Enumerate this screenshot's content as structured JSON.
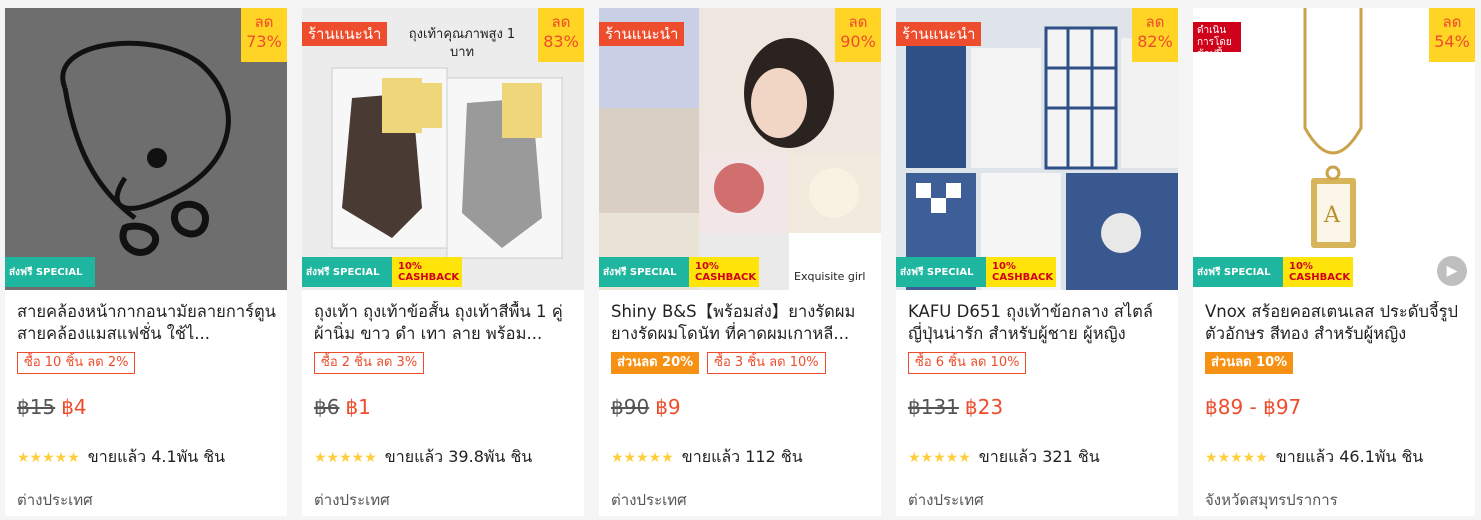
{
  "products": [
    {
      "image_bg": "#6a6a6a",
      "discount_word": "ลด",
      "discount_pct": "73%",
      "badge": "",
      "cashback": "",
      "title": "สายคล้องหน้ากากอนามัยลายการ์ตูน สายคล้องแมสแฟชั่น ใช้ไ...",
      "promos": [
        {
          "type": "box",
          "text": "ซื้อ 10 ชิ้น ลด 2%"
        }
      ],
      "price_old": "฿15",
      "price_new": "฿4",
      "sold": "ขายแล้ว 4.1พัน ชิน",
      "location": "ต่างประเทศ"
    },
    {
      "image_bg": "#e8e8e8",
      "discount_word": "ลด",
      "discount_pct": "83%",
      "badge": "ร้านแนะนำ",
      "image_caption": "ถุงเท้าคุณภาพสูง 1 บาท",
      "cashback": "10%",
      "title": "ถุงเท้า ถุงเท้าข้อสั้น ถุงเท้าสีพื้น 1 คู่ ผ้านิ่ม ขาว ดำ เทา ลาย พร้อม...",
      "promos": [
        {
          "type": "box",
          "text": "ซื้อ 2 ชิ้น ลด 3%"
        }
      ],
      "price_old": "฿6",
      "price_new": "฿1",
      "sold": "ขายแล้ว 39.8พัน ชิน",
      "location": "ต่างประเทศ"
    },
    {
      "image_bg": "#dcd6cf",
      "discount_word": "ลด",
      "discount_pct": "90%",
      "badge": "ร้านแนะนำ",
      "image_caption": "Exquisite girl",
      "cashback": "10%",
      "title": "Shiny B&S【พร้อมส่ง】ยางรัดผม ยางรัดผมโดนัท ที่คาดผมเกาหลี...",
      "promos": [
        {
          "type": "fill",
          "text": "ส่วนลด 20%"
        },
        {
          "type": "box",
          "text": "ซื้อ 3 ชิ้น ลด 10%"
        }
      ],
      "price_old": "฿90",
      "price_new": "฿9",
      "sold": "ขายแล้ว 112 ชิน",
      "location": "ต่างประเทศ"
    },
    {
      "image_bg": "#3d5a8a",
      "discount_word": "ลด",
      "discount_pct": "82%",
      "badge": "ร้านแนะนำ",
      "cashback": "10%",
      "title": "KAFU D651 ถุงเท้าข้อกลาง สไตล์ญี่ปุ่นน่ารัก สำหรับผู้ชาย ผู้หญิง",
      "promos": [
        {
          "type": "box",
          "text": "ซื้อ 6 ชิ้น ลด 10%"
        }
      ],
      "price_old": "฿131",
      "price_new": "฿23",
      "sold": "ขายแล้ว 321 ชิน",
      "location": "ต่างประเทศ"
    },
    {
      "image_bg": "#ffffff",
      "discount_word": "ลด",
      "discount_pct": "54%",
      "badge": "ดำเนินการโดยช้อปปี้",
      "cashback": "10%",
      "title": "Vnox สร้อยคอสเตนเลส ประดับจี้รูปตัวอักษร สีทอง สำหรับผู้หญิง",
      "promos": [
        {
          "type": "fill",
          "text": "ส่วนลด 10%"
        }
      ],
      "price_old": "",
      "price_new": "฿89 - ฿97",
      "sold": "ขายแล้ว 46.1พัน ชิน",
      "location": "จังหวัดสมุทรปราการ"
    }
  ],
  "shipping_label": "ส่งฟรี SPECIAL",
  "cashback_suffix": "CASHBACK",
  "stars": "★★★★★"
}
